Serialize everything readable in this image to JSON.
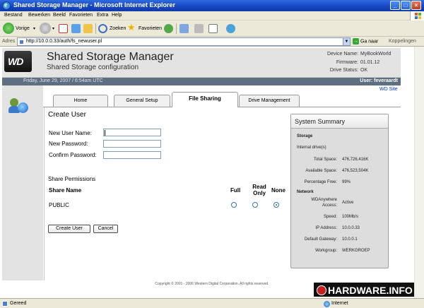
{
  "window": {
    "title": "Shared Storage Manager - Microsoft Internet Explorer",
    "controls": {
      "minimize": "_",
      "maximize": "□",
      "close": "×"
    }
  },
  "menu": [
    "Bestand",
    "Bewerken",
    "Beeld",
    "Favorieten",
    "Extra",
    "Help"
  ],
  "toolbar": {
    "back": "Vorige",
    "search": "Zoeken",
    "favorites": "Favorieten"
  },
  "address": {
    "label": "Adres",
    "url": "http://10.0.0.33/auth/fs_newuser.pl",
    "go": "Ga naar",
    "links": "Koppelingen"
  },
  "header": {
    "logo": "WD",
    "title": "Shared Storage Manager",
    "subtitle": "Shared Storage configuration",
    "device_name_label": "Device Name:",
    "device_name": "MyBookWorld",
    "firmware_label": "Firmware:",
    "firmware": "01.01.12",
    "drive_status_label": "Drive Status:",
    "drive_status": "OK",
    "date": "Friday, June 29, 2007 / 6:54am UTC",
    "user": "User: feveraardt",
    "wd_site": "WD Site"
  },
  "tabs": [
    "Home",
    "General Setup",
    "File Sharing",
    "Drive Management"
  ],
  "active_tab": "File Sharing",
  "form": {
    "heading": "Create User",
    "username_label": "New User Name:",
    "password_label": "New Password:",
    "confirm_label": "Confirm Password:",
    "username_value": "",
    "password_value": "",
    "confirm_value": ""
  },
  "permissions": {
    "heading": "Share Permissions",
    "col_share": "Share Name",
    "col_full": "Full",
    "col_readonly_1": "Read",
    "col_readonly_2": "Only",
    "col_none": "None",
    "rows": [
      {
        "share": "PUBLIC",
        "selected": "None"
      }
    ]
  },
  "buttons": {
    "create": "Create User",
    "cancel": "Cancel"
  },
  "summary": {
    "title": "System Summary",
    "storage_label": "Storage",
    "drives_label": "Internal drive(s)",
    "total_label": "Total Space:",
    "total": "476,726,416K",
    "available_label": "Available Space:",
    "available": "476,523,504K",
    "free_label": "Percentage Free:",
    "free": "99%",
    "network_label": "Network",
    "wdanywhere_label_1": "WDAnywhere",
    "wdanywhere_label_2": "Access:",
    "wdanywhere": "Active",
    "speed_label": "Speed:",
    "speed": "100Mb/s",
    "ip_label": "IP Address:",
    "ip": "10.0.0.33",
    "gateway_label": "Default Gateway:",
    "gateway": "10.0.0.1",
    "workgroup_label": "Workgroup:",
    "workgroup": "WERKGROEP"
  },
  "copyright": "Copyright © 2001 - 2006 Western Digital Corporation. All rights reserved.",
  "watermark": "HARDWARE.INFO",
  "status": {
    "text": "Gereed",
    "zone": "Internet"
  }
}
